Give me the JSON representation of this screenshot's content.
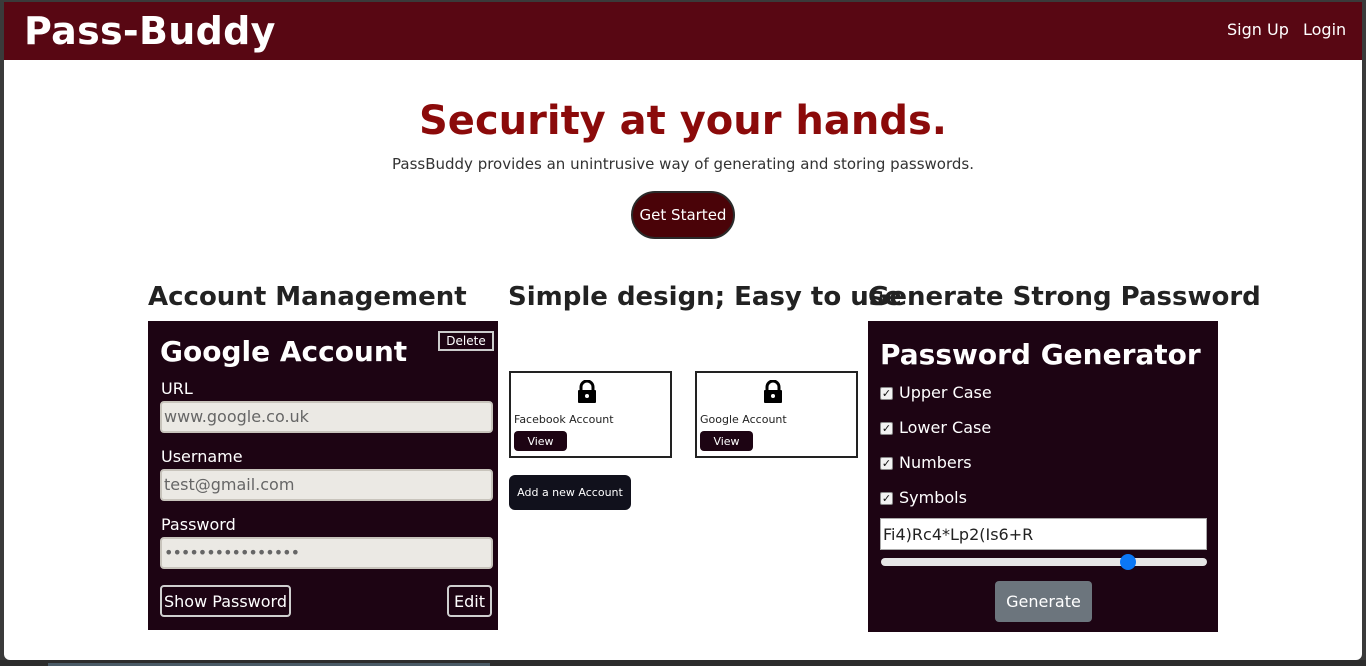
{
  "brand": "Pass-Buddy",
  "nav": {
    "signup": "Sign Up",
    "login": "Login"
  },
  "hero": {
    "title": "Security at your hands.",
    "subtitle": "PassBuddy provides an unintrusive way of generating and storing passwords.",
    "cta": "Get Started"
  },
  "sections": {
    "account_management": "Account Management",
    "simple_design": "Simple design; Easy to use",
    "generate": "Generate Strong Password"
  },
  "account_card": {
    "title": "Google Account",
    "delete": "Delete",
    "url_label": "URL",
    "url_value": "www.google.co.uk",
    "username_label": "Username",
    "username_value": "test@gmail.com",
    "password_label": "Password",
    "password_value": "••••••••••••••••",
    "show_password": "Show Password",
    "edit": "Edit"
  },
  "accounts": [
    {
      "name": "Facebook Account",
      "view": "View",
      "icon": "lock-icon"
    },
    {
      "name": "Google Account",
      "view": "View",
      "icon": "lock-icon"
    }
  ],
  "add_account": "Add a new Account",
  "generator": {
    "title": "Password Generator",
    "options": [
      {
        "label": "Upper Case",
        "checked": true
      },
      {
        "label": "Lower Case",
        "checked": true
      },
      {
        "label": "Numbers",
        "checked": true
      },
      {
        "label": "Symbols",
        "checked": true
      }
    ],
    "password": "Fi4)Rc4*Lp2(Is6+R",
    "length_fraction": 0.77,
    "generate": "Generate"
  },
  "colors": {
    "brand": "#580713",
    "accent": "#8b0a0a",
    "panel": "#1d0413",
    "slider": "#0b77f5"
  }
}
